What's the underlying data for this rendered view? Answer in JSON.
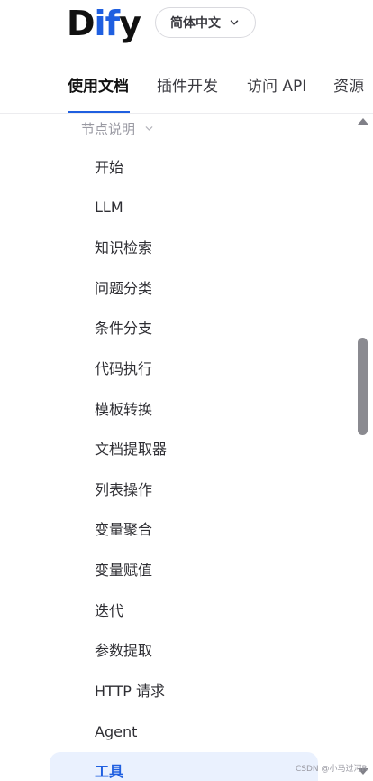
{
  "header": {
    "logo": {
      "d": "D",
      "i": "i",
      "f": "f",
      "y": "y"
    },
    "language": {
      "label": "简体中文",
      "icon": "chevron-down-icon"
    }
  },
  "tabs": [
    {
      "label": "使用文档",
      "active": true
    },
    {
      "label": "插件开发",
      "active": false
    },
    {
      "label": "访问 API",
      "active": false
    },
    {
      "label": "资源",
      "active": false
    }
  ],
  "nav": {
    "section": {
      "label": "节点说明",
      "icon": "chevron-down-icon"
    },
    "items": [
      "开始",
      "LLM",
      "知识检索",
      "问题分类",
      "条件分支",
      "代码执行",
      "模板转换",
      "文档提取器",
      "列表操作",
      "变量聚合",
      "变量赋值",
      "迭代",
      "参数提取",
      "HTTP 请求",
      "Agent",
      "工具"
    ],
    "active_item": "工具"
  },
  "watermark": "CSDN @小马过河R",
  "colors": {
    "accent": "#1f5fe0",
    "active_bg": "#eaf1fe",
    "text": "#2e2e33",
    "muted": "#9a9aa3"
  }
}
